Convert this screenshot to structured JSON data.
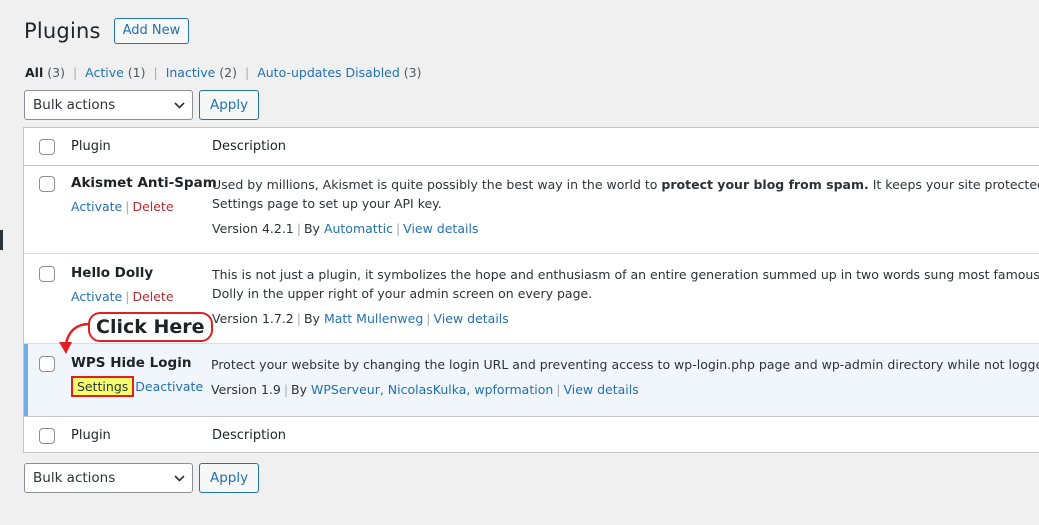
{
  "header": {
    "title": "Plugins",
    "add_new_label": "Add New"
  },
  "filters": [
    {
      "label": "All",
      "count": "(3)",
      "current": true
    },
    {
      "label": "Active",
      "count": "(1)"
    },
    {
      "label": "Inactive",
      "count": "(2)"
    },
    {
      "label": "Auto-updates Disabled",
      "count": "(3)"
    }
  ],
  "bulk": {
    "select_value": "Bulk actions",
    "apply_label": "Apply"
  },
  "table": {
    "col_plugin": "Plugin",
    "col_description": "Description",
    "plugins": [
      {
        "name": "Akismet Anti-Spam",
        "actions": [
          "Activate",
          "Delete"
        ],
        "desc_pre": "Used by millions, Akismet is quite possibly the best way in the world to ",
        "desc_bold": "protect your blog from spam.",
        "desc_post": " It keeps your site protected even while you",
        "desc_line2": "Settings page to set up your API key.",
        "version": "Version 4.2.1",
        "by": "By",
        "author": "Automattic",
        "details": "View details"
      },
      {
        "name": "Hello Dolly",
        "actions": [
          "Activate",
          "Delete"
        ],
        "desc_line1": "This is not just a plugin, it symbolizes the hope and enthusiasm of an entire generation summed up in two words sung most famously by Louis Ar",
        "desc_line2": "Dolly in the upper right of your admin screen on every page.",
        "version": "Version 1.7.2",
        "by": "By",
        "author": "Matt Mullenweg",
        "details": "View details"
      },
      {
        "name": "WPS Hide Login",
        "actions": [
          "Settings",
          "Deactivate"
        ],
        "desc_line1": "Protect your website by changing the login URL and preventing access to wp-login.php page and wp-admin directory while not logged-in",
        "version": "Version 1.9",
        "by": "By",
        "author": "WPServeur, NicolasKulka, wpformation",
        "details": "View details"
      }
    ]
  },
  "annotation": {
    "callout_text": "Click Here",
    "color": "#e02020",
    "highlight": "#f5ff6e"
  }
}
